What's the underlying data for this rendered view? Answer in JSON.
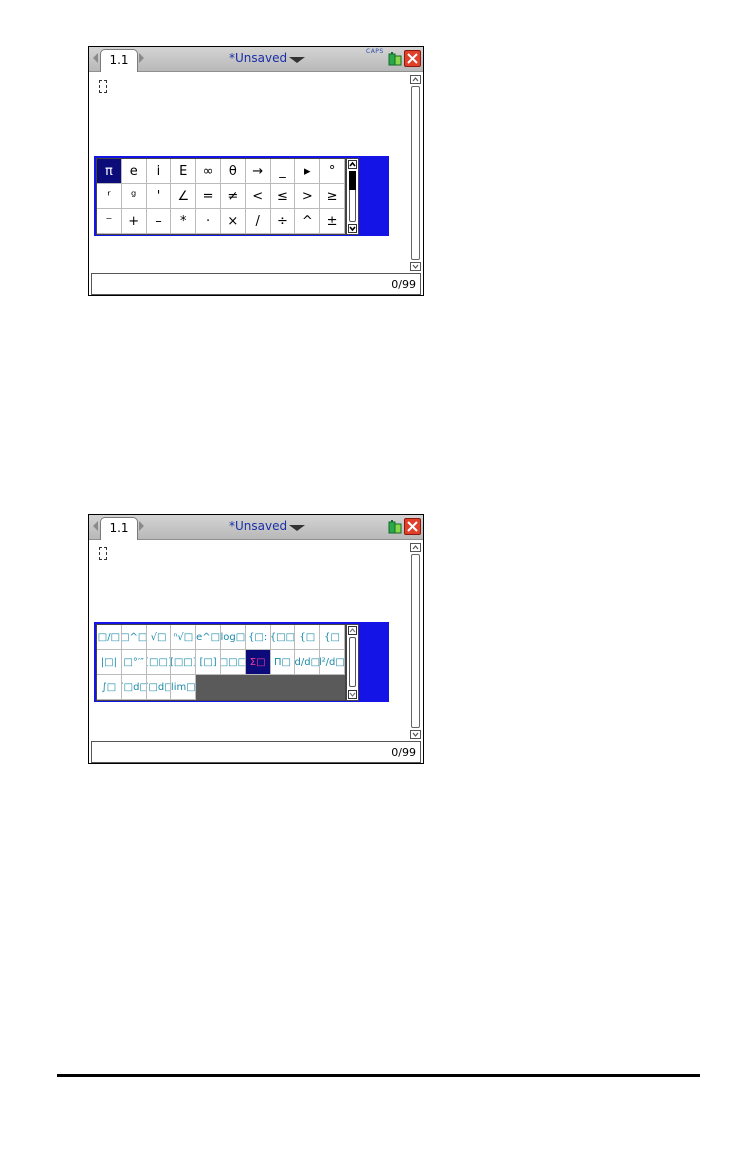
{
  "screens": [
    {
      "tab_label": "1.1",
      "doc_title": "*Unsaved",
      "caps_indicator": "CAPS",
      "entry_count": "0/99",
      "palette": {
        "type": "symbols",
        "selected_index": 0,
        "scroll_thumb_position": "top",
        "cells": [
          "π",
          "e",
          "i",
          "E",
          "∞",
          "θ",
          "→",
          "_",
          "▸",
          "°",
          "ʳ",
          "ᵍ",
          "'",
          "∠",
          "=",
          "≠",
          "<",
          "≤",
          ">",
          "≥",
          "⁻",
          "+",
          "–",
          "*",
          "·",
          "×",
          "/",
          "÷",
          "^",
          "±"
        ]
      }
    },
    {
      "tab_label": "1.1",
      "doc_title": "*Unsaved",
      "entry_count": "0/99",
      "palette": {
        "type": "templates",
        "selected_index": 16,
        "cells": [
          "□/□",
          "□^□",
          "√□",
          "ⁿ√□",
          "e^□",
          "log□",
          "{□:",
          "{□□",
          "{□",
          "{□",
          "|□|",
          "□°′″",
          "[□□]",
          "[□□]",
          "[□]",
          "[□□□]",
          "Σ□",
          "Π□",
          "d/d□",
          "d²/d□²",
          "∫□",
          "∫□d□",
          "∫□d□",
          "lim□"
        ]
      }
    }
  ]
}
